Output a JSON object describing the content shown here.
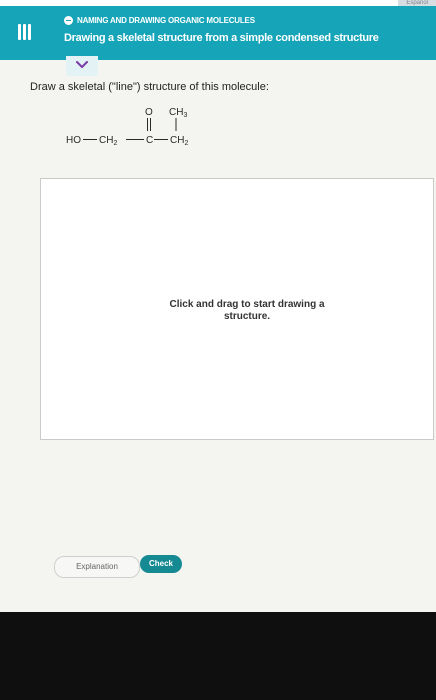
{
  "header": {
    "corner_label": "Español",
    "section": "NAMING AND DRAWING ORGANIC MOLECULES",
    "title": "Drawing a skeletal structure from a simple condensed structure"
  },
  "prompt": "Draw a skeletal (\"line\") structure of this molecule:",
  "molecule": {
    "ho": "HO",
    "ch": "CH",
    "sub2": "2",
    "sub3": "3",
    "o": "O",
    "c": "C"
  },
  "canvas": {
    "hint_line1": "Click and drag to start drawing a",
    "hint_line2": "structure."
  },
  "buttons": {
    "explanation": "Explanation",
    "check": "Check"
  },
  "colors": {
    "header": "#16a5b8",
    "check": "#158a93"
  }
}
